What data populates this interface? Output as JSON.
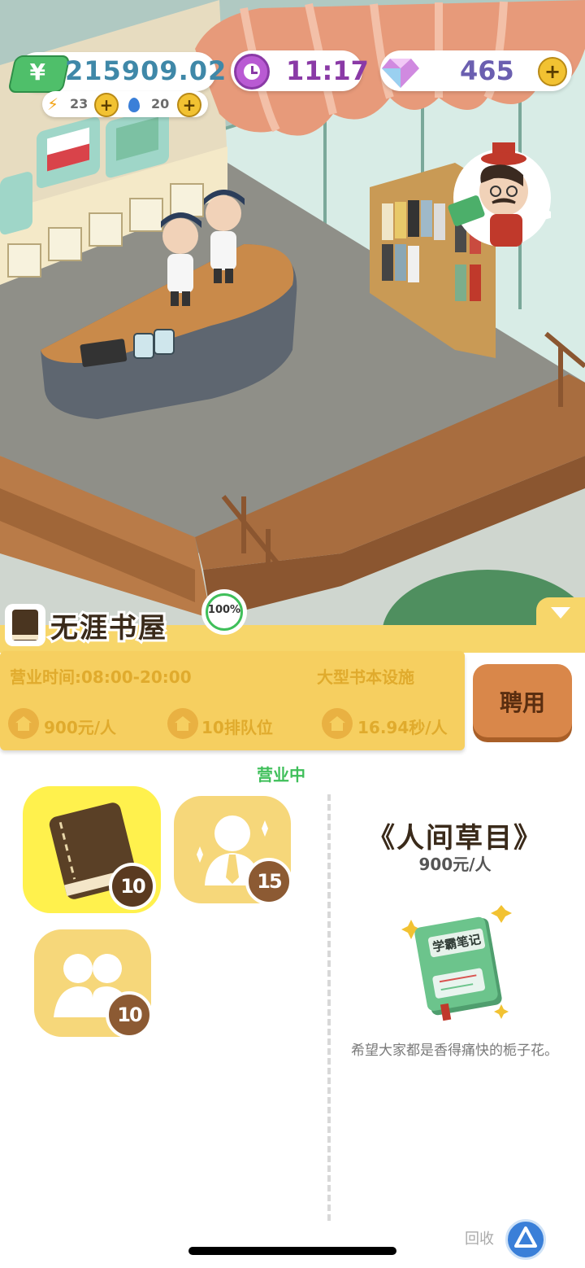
{
  "hud": {
    "money": "215909.02",
    "energy": "23",
    "water": "20",
    "time": "11:17",
    "gems": "465",
    "plus_symbol": "+"
  },
  "shop": {
    "name": "无涯书屋",
    "progress_label": "100%",
    "hours": "营业时间:08:00-20:00",
    "facility": "大型书本设施",
    "price": "900元/人",
    "queue": "10排队位",
    "speed": "16.94秒/人",
    "hire_label": "聘用",
    "status": "营业中"
  },
  "cards": [
    {
      "name": "book",
      "count": "10"
    },
    {
      "name": "staff",
      "count": "15"
    },
    {
      "name": "customers",
      "count": "10"
    }
  ],
  "book_detail": {
    "title": "《人间草目》",
    "price": "900元/人",
    "cover_text": "学霸笔记",
    "description": "希望大家都是香得痛快的栀子花。"
  },
  "recycle_label": "回收",
  "colors": {
    "accent_yellow": "#f6cf60",
    "status_green": "#3fbf5a",
    "hire_button": "#d9874a"
  }
}
